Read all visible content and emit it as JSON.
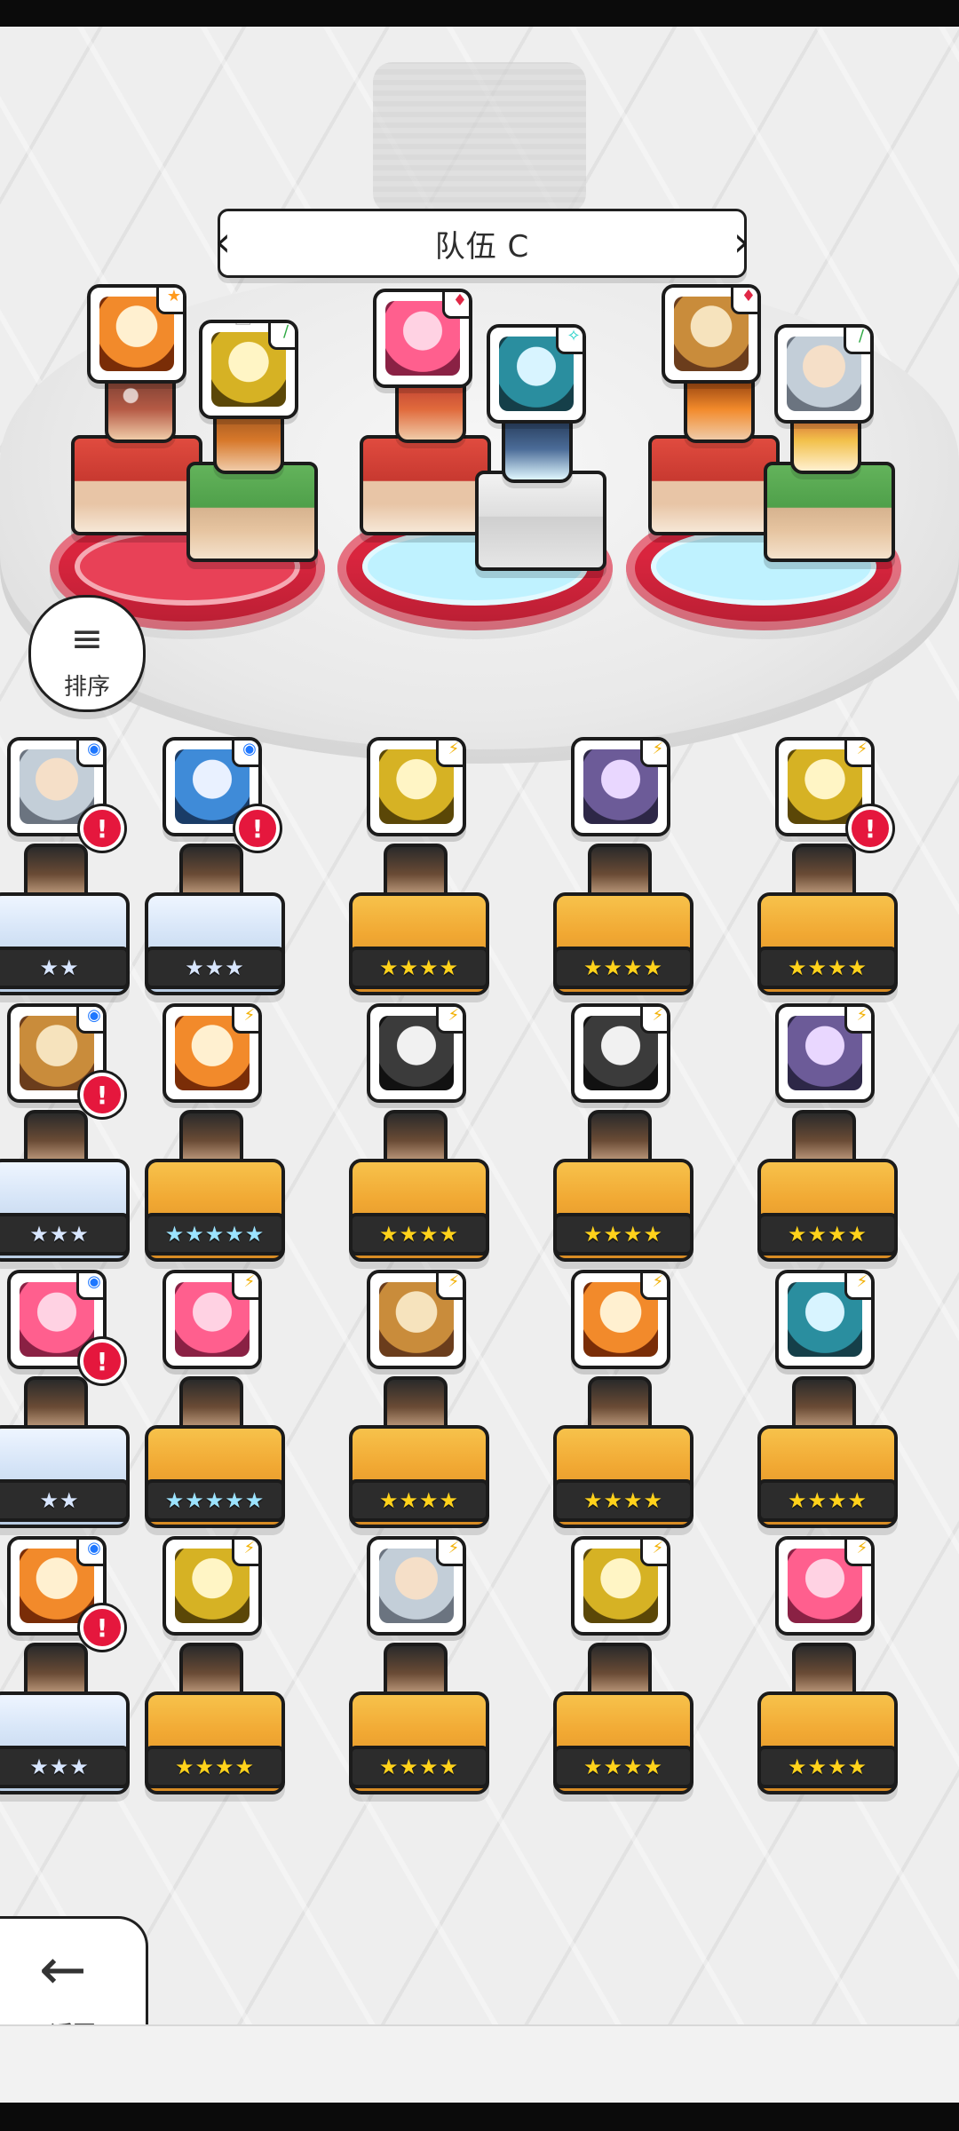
{
  "header": {
    "team_title": "队伍 C"
  },
  "buttons": {
    "sort": {
      "label": "排序"
    },
    "back": {
      "label": "返回"
    }
  },
  "team_slots": [
    {
      "portraits": [
        {
          "badge": "★",
          "badge_type": "star"
        },
        {
          "badge": "♛",
          "badge_type": "crown",
          "secondary_badge": "∕",
          "secondary_type": "green"
        }
      ]
    },
    {
      "portraits": [
        {
          "badge": "♦",
          "badge_type": "red"
        },
        {
          "badge": "✧",
          "badge_type": "sparkle"
        }
      ]
    },
    {
      "portraits": [
        {
          "badge": "♦",
          "badge_type": "red"
        },
        {
          "badge": "∕",
          "badge_type": "green"
        }
      ]
    }
  ],
  "roster": {
    "rows": [
      [
        {
          "stars": "★★",
          "tier": "silver",
          "badge": "◉",
          "badge_type": "blue",
          "alert": true
        },
        {
          "stars": "★★★",
          "tier": "silver",
          "badge": "◉",
          "badge_type": "blue",
          "alert": true
        },
        {
          "stars": "★★★★",
          "tier": "gold",
          "badge": "⚡",
          "badge_type": "yellow",
          "alert": false
        },
        {
          "stars": "★★★★",
          "tier": "gold",
          "badge": "⚡",
          "badge_type": "yellow",
          "alert": false
        },
        {
          "stars": "★★★★",
          "tier": "gold",
          "badge": "⚡",
          "badge_type": "yellow",
          "alert": true
        }
      ],
      [
        {
          "stars": "★★★",
          "tier": "silver",
          "badge": "◉",
          "badge_type": "blue",
          "alert": true
        },
        {
          "stars": "★★★★★",
          "tier": "mix",
          "badge": "⚡",
          "badge_type": "yellow",
          "alert": false
        },
        {
          "stars": "★★★★",
          "tier": "gold",
          "badge": "⚡",
          "badge_type": "yellow",
          "alert": false
        },
        {
          "stars": "★★★★",
          "tier": "gold",
          "badge": "⚡",
          "badge_type": "yellow",
          "alert": false
        },
        {
          "stars": "★★★★",
          "tier": "gold",
          "badge": "⚡",
          "badge_type": "yellow",
          "alert": false
        }
      ],
      [
        {
          "stars": "★★",
          "tier": "silver",
          "badge": "◉",
          "badge_type": "blue",
          "alert": true
        },
        {
          "stars": "★★★★★",
          "tier": "mix",
          "badge": "⚡",
          "badge_type": "yellow",
          "alert": false
        },
        {
          "stars": "★★★★",
          "tier": "gold",
          "badge": "⚡",
          "badge_type": "yellow",
          "alert": false
        },
        {
          "stars": "★★★★",
          "tier": "gold",
          "badge": "⚡",
          "badge_type": "yellow",
          "alert": false
        },
        {
          "stars": "★★★★",
          "tier": "gold",
          "badge": "⚡",
          "badge_type": "yellow",
          "alert": false
        }
      ],
      [
        {
          "stars": "★★★",
          "tier": "silver",
          "badge": "◉",
          "badge_type": "blue",
          "alert": true
        },
        {
          "stars": "★★★★",
          "tier": "gold",
          "badge": "⚡",
          "badge_type": "yellow",
          "alert": false
        },
        {
          "stars": "★★★★",
          "tier": "gold",
          "badge": "⚡",
          "badge_type": "yellow",
          "alert": false
        },
        {
          "stars": "★★★★",
          "tier": "gold",
          "badge": "⚡",
          "badge_type": "yellow",
          "alert": false
        },
        {
          "stars": "★★★★",
          "tier": "gold",
          "badge": "⚡",
          "badge_type": "yellow",
          "alert": false
        }
      ]
    ]
  },
  "icons": {
    "sort": "sort-icon",
    "back": "back-arrow-icon",
    "arrow_left": "chevron-left-icon",
    "arrow_right": "chevron-right-icon"
  },
  "colors": {
    "pad_red": "#d9253e",
    "pad_cyan": "#bff2ff",
    "alert_red": "#e5173d",
    "gold": "#f1a833",
    "silver": "#d5e4f7"
  }
}
